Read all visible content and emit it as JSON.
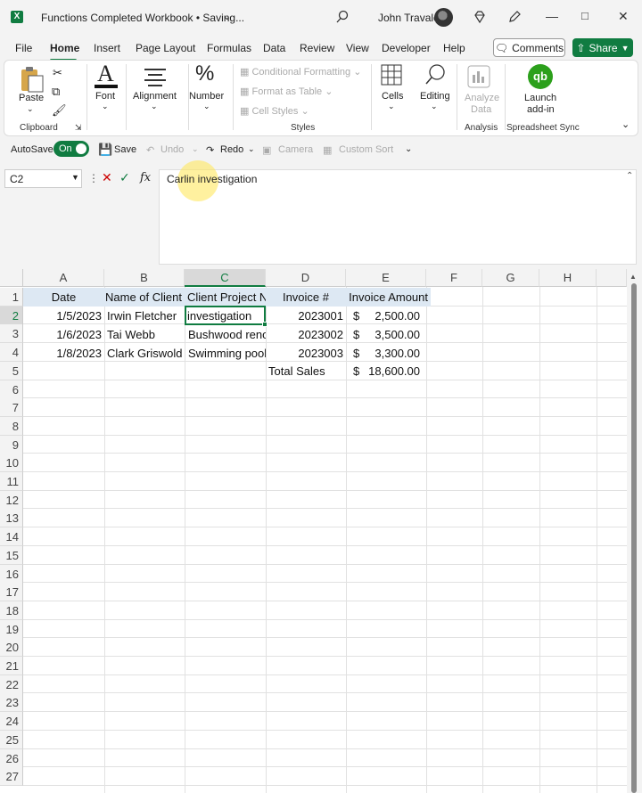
{
  "window": {
    "app_icon": "excel-icon",
    "title": "Functions Completed Workbook • Saving...",
    "user": "John Travale"
  },
  "menu": {
    "items": [
      "File",
      "Home",
      "Insert",
      "Page Layout",
      "Formulas",
      "Data",
      "Review",
      "View",
      "Developer",
      "Help"
    ],
    "active": "Home",
    "comments_label": "Comments",
    "share_label": "Share"
  },
  "ribbon": {
    "clipboard": {
      "paste": "Paste",
      "group": "Clipboard"
    },
    "font": "Font",
    "alignment": "Alignment",
    "number": "Number",
    "styles": {
      "conditional": "Conditional Formatting",
      "format_table": "Format as Table",
      "cell_styles": "Cell Styles",
      "group": "Styles"
    },
    "cells": "Cells",
    "editing": "Editing",
    "analyze": {
      "line1": "Analyze",
      "line2": "Data",
      "group": "Analysis"
    },
    "launch": {
      "line1": "Launch",
      "line2": "add-in",
      "group": "Spreadsheet Sync"
    }
  },
  "quick_access": {
    "autosave": "AutoSave",
    "toggle": "On",
    "save": "Save",
    "undo": "Undo",
    "redo": "Redo",
    "camera": "Camera",
    "custom_sort": "Custom Sort"
  },
  "formula_bar": {
    "name_box": "C2",
    "fx": "fx",
    "value": "Carlin investigation"
  },
  "sheet": {
    "columns": [
      "A",
      "B",
      "C",
      "D",
      "E",
      "F",
      "G",
      "H"
    ],
    "selected_column": "C",
    "selected_row": "2",
    "rows": [
      "1",
      "2",
      "3",
      "4",
      "5",
      "6",
      "7",
      "8",
      "9",
      "10",
      "11",
      "12",
      "13",
      "14",
      "15",
      "16",
      "17",
      "18",
      "19",
      "20",
      "21",
      "22",
      "23",
      "24",
      "25",
      "26",
      "27"
    ],
    "header": {
      "a": "Date",
      "b": "Name of Client",
      "c": "Client Project Name",
      "d": "Invoice #",
      "e": "Invoice Amount"
    },
    "data": [
      {
        "a": "1/5/2023",
        "b": "Irwin Fletcher",
        "c": "investigation",
        "d": "2023001",
        "e_sym": "$",
        "e": "2,500.00"
      },
      {
        "a": "1/6/2023",
        "b": "Tai Webb",
        "c": "Bushwood renovation",
        "d": "2023002",
        "e_sym": "$",
        "e": "3,500.00"
      },
      {
        "a": "1/8/2023",
        "b": "Clark Griswold",
        "c": "Swimming pool",
        "d": "2023003",
        "e_sym": "$",
        "e": "3,300.00"
      }
    ],
    "total": {
      "label": "Total Sales",
      "sym": "$",
      "value": "18,600.00"
    }
  }
}
